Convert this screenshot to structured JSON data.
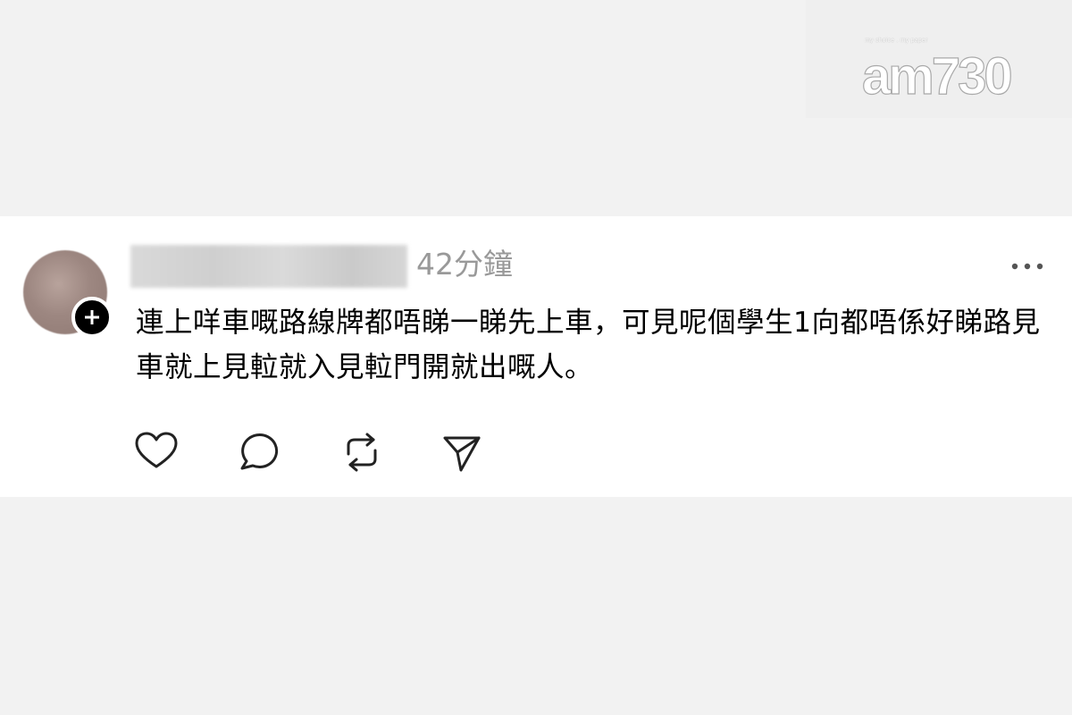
{
  "watermark": {
    "tagline": "my choice . my paper",
    "brand": "am730"
  },
  "post": {
    "username": "",
    "time": "42分鐘",
    "text": "連上咩車嘅路線牌都唔睇一睇先上車，可見呢個學生1向都唔係好睇路見車就上見𨋢就入見𨋢門開就出嘅人。",
    "actions": [
      {
        "icon": "heart-icon"
      },
      {
        "icon": "comment-icon"
      },
      {
        "icon": "repost-icon"
      },
      {
        "icon": "share-icon"
      }
    ]
  }
}
